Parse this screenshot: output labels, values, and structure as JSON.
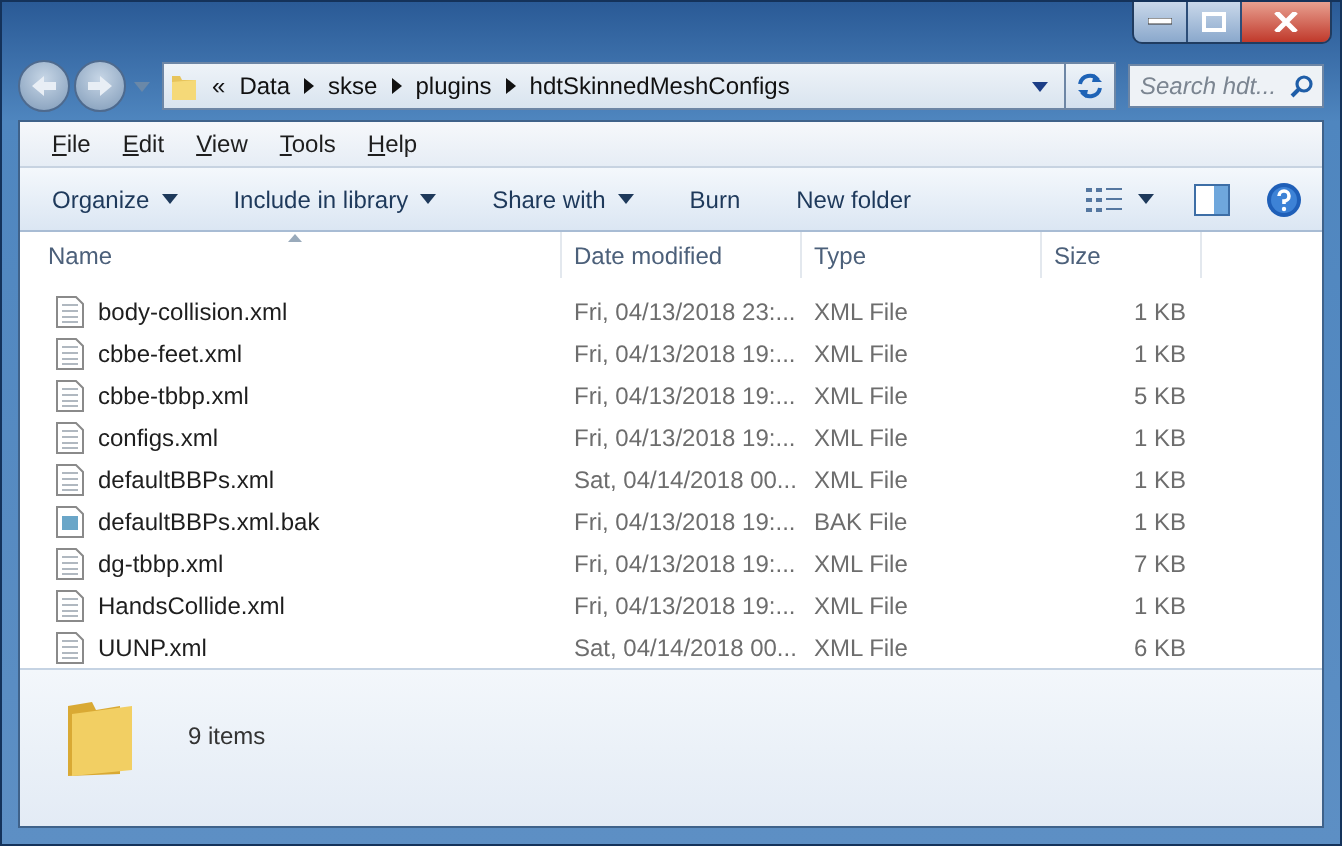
{
  "address": {
    "overflow": "«",
    "crumbs": [
      "Data",
      "skse",
      "plugins",
      "hdtSkinnedMeshConfigs"
    ]
  },
  "search": {
    "placeholder": "Search hdt..."
  },
  "menu": [
    "File",
    "Edit",
    "View",
    "Tools",
    "Help"
  ],
  "commands": [
    {
      "label": "Organize",
      "dropdown": true
    },
    {
      "label": "Include in library",
      "dropdown": true
    },
    {
      "label": "Share with",
      "dropdown": true
    },
    {
      "label": "Burn",
      "dropdown": false
    },
    {
      "label": "New folder",
      "dropdown": false
    }
  ],
  "columns": [
    "Name",
    "Date modified",
    "Type",
    "Size"
  ],
  "files": [
    {
      "name": "body-collision.xml",
      "date": "Fri, 04/13/2018 23:...",
      "type": "XML File",
      "size": "1 KB",
      "kind": "document"
    },
    {
      "name": "cbbe-feet.xml",
      "date": "Fri, 04/13/2018 19:...",
      "type": "XML File",
      "size": "1 KB",
      "kind": "document"
    },
    {
      "name": "cbbe-tbbp.xml",
      "date": "Fri, 04/13/2018 19:...",
      "type": "XML File",
      "size": "5 KB",
      "kind": "document"
    },
    {
      "name": "configs.xml",
      "date": "Fri, 04/13/2018 19:...",
      "type": "XML File",
      "size": "1 KB",
      "kind": "document"
    },
    {
      "name": "defaultBBPs.xml",
      "date": "Sat, 04/14/2018 00...",
      "type": "XML File",
      "size": "1 KB",
      "kind": "document"
    },
    {
      "name": "defaultBBPs.xml.bak",
      "date": "Fri, 04/13/2018 19:...",
      "type": "BAK File",
      "size": "1 KB",
      "kind": "unknown"
    },
    {
      "name": "dg-tbbp.xml",
      "date": "Fri, 04/13/2018 19:...",
      "type": "XML File",
      "size": "7 KB",
      "kind": "document"
    },
    {
      "name": "HandsCollide.xml",
      "date": "Fri, 04/13/2018 19:...",
      "type": "XML File",
      "size": "1 KB",
      "kind": "document"
    },
    {
      "name": "UUNP.xml",
      "date": "Sat, 04/14/2018 00...",
      "type": "XML File",
      "size": "6 KB",
      "kind": "document"
    }
  ],
  "status": {
    "count": "9 items"
  }
}
